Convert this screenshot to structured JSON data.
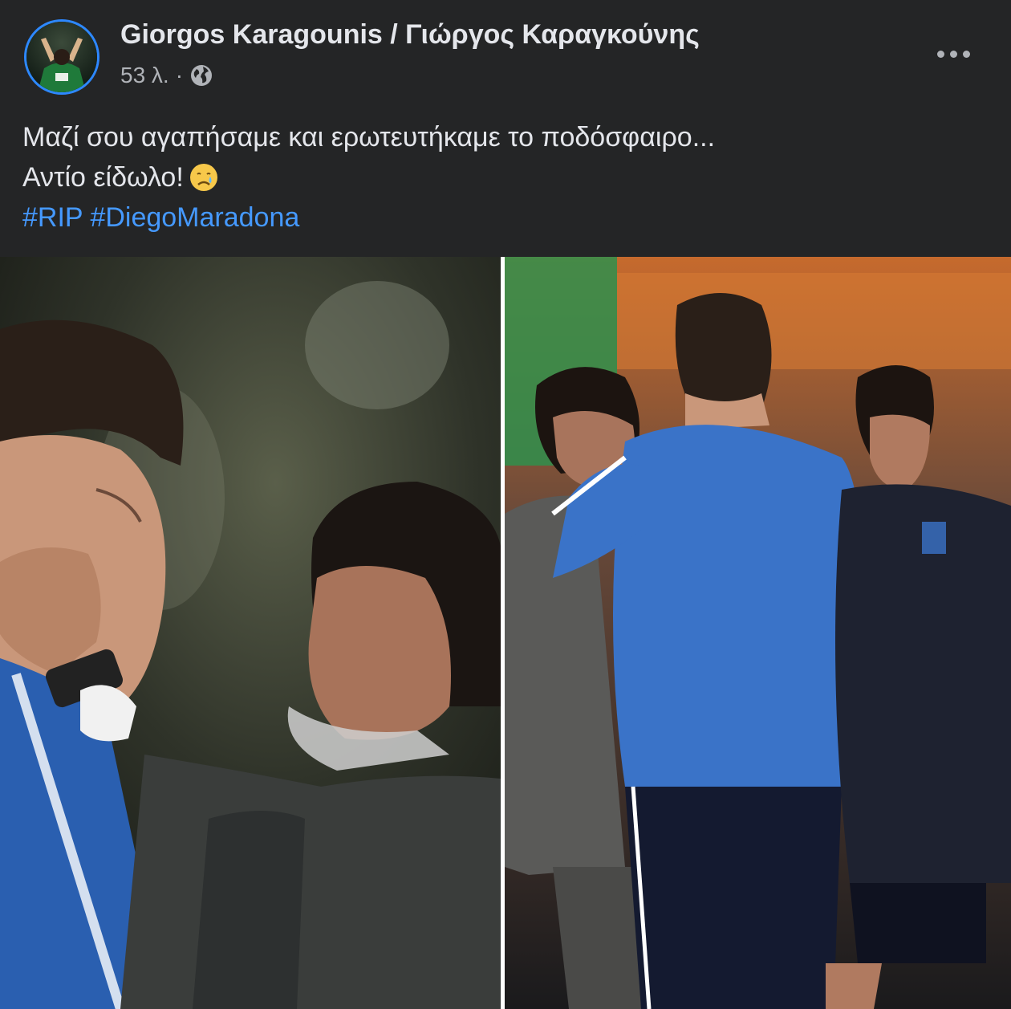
{
  "post": {
    "author": "Giorgos Karagounis / Γιώργος Καραγκούνης",
    "timestamp": "53 λ.",
    "separator": "·",
    "privacy_icon": "globe-icon",
    "more_icon": "more-options-icon",
    "text_line1": "Μαζί σου αγαπήσαμε και ερωτευτήκαμε το ποδόσφαιρο...",
    "text_line2": "Αντίο είδωλο!",
    "emoji": "crying-face-icon",
    "hashtags": [
      "#RIP",
      "#DiegoMaradona"
    ]
  },
  "colors": {
    "background": "#242526",
    "primary_text": "#e4e6eb",
    "secondary_text": "#b0b3b8",
    "link": "#4599ff",
    "avatar_ring": "#2d88ff"
  }
}
